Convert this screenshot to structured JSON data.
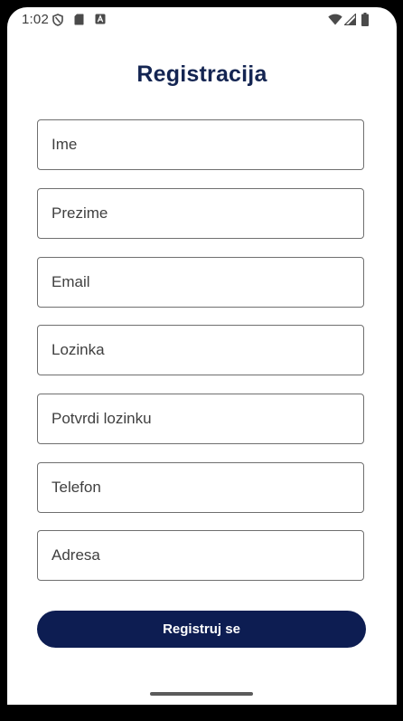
{
  "status_bar": {
    "time": "1:02",
    "icons": [
      "shield-icon",
      "sd-card-icon",
      "accessibility-a-icon",
      "wifi-icon",
      "signal-icon",
      "battery-icon"
    ]
  },
  "title": "Registracija",
  "form": {
    "fields": [
      {
        "name": "first-name",
        "placeholder": "Ime"
      },
      {
        "name": "last-name",
        "placeholder": "Prezime"
      },
      {
        "name": "email",
        "placeholder": "Email"
      },
      {
        "name": "password",
        "placeholder": "Lozinka"
      },
      {
        "name": "confirm-password",
        "placeholder": "Potvrdi lozinku"
      },
      {
        "name": "phone",
        "placeholder": "Telefon"
      },
      {
        "name": "address",
        "placeholder": "Adresa"
      }
    ],
    "submit_label": "Registruj se"
  },
  "colors": {
    "title": "#142552",
    "button_bg": "#0d1d52",
    "button_text": "#ffffff",
    "field_border": "#6f6f6f"
  }
}
